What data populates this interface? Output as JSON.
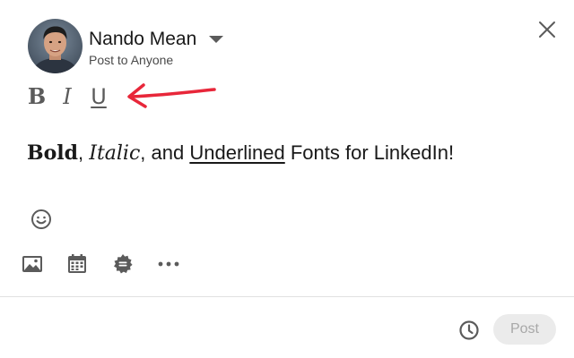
{
  "author": {
    "name": "Nando Mean",
    "visibility": "Post to Anyone"
  },
  "formatting_toolbar": {
    "bold_label": "B",
    "italic_label": "I",
    "underline_label": "U"
  },
  "post": {
    "bold": "Bold",
    "sep1": ", ",
    "italic": "Italic",
    "sep2": ", and ",
    "underlined": "Underlined",
    "rest": " Fonts for LinkedIn!"
  },
  "actions": {
    "post_label": "Post"
  },
  "icons": {
    "close": "close-icon",
    "caret": "chevron-down-icon",
    "emoji": "emoji-icon",
    "photo": "photo-icon",
    "event": "calendar-icon",
    "badge": "celebrate-badge-icon",
    "more": "more-icon",
    "schedule": "clock-icon",
    "annotation": "red-arrow-icon"
  },
  "colors": {
    "annotation_arrow": "#e8273a",
    "icon_gray": "#5b5b5b",
    "post_button_bg": "#ebebeb",
    "post_button_text": "#a8a8a8"
  }
}
